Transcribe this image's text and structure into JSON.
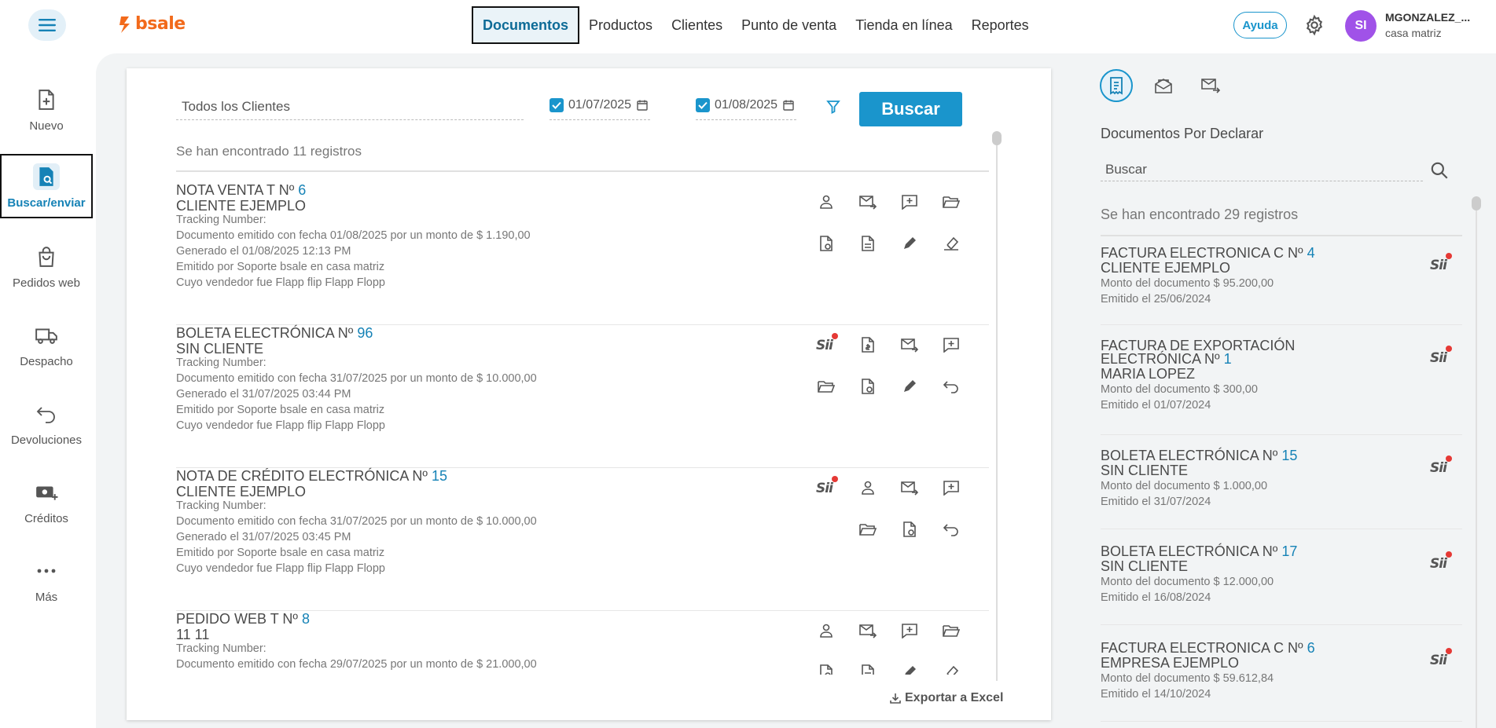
{
  "header": {
    "logo_text": "bsale",
    "nav": [
      "Documentos",
      "Productos",
      "Clientes",
      "Punto de venta",
      "Tienda en línea",
      "Reportes"
    ],
    "active_nav": "Documentos",
    "help_label": "Ayuda",
    "avatar_initials": "SI",
    "user_name": "MGONZALEZ_...",
    "user_branch": "casa matriz"
  },
  "sidebar": {
    "items": [
      {
        "label": "Nuevo",
        "icon": "file-plus-icon"
      },
      {
        "label": "Buscar/enviar",
        "icon": "file-search-icon",
        "active": true
      },
      {
        "label": "Pedidos web",
        "icon": "shopping-bag-icon"
      },
      {
        "label": "Despacho",
        "icon": "truck-icon"
      },
      {
        "label": "Devoluciones",
        "icon": "return-arrow-icon"
      },
      {
        "label": "Créditos",
        "icon": "money-plus-icon"
      },
      {
        "label": "Más",
        "icon": "more-dots-icon"
      }
    ]
  },
  "filters": {
    "client": "Todos los Clientes",
    "date_from": "01/07/2025",
    "date_to": "01/08/2025",
    "search_label": "Buscar"
  },
  "results": {
    "found_text": "Se han encontrado 11 registros",
    "documents": [
      {
        "title": "NOTA VENTA T Nº",
        "number": "6",
        "client": "CLIENTE EJEMPLO",
        "tracking": "Tracking Number:",
        "issued": "Documento emitido con fecha 01/08/2025 por un monto de $ 1.190,00",
        "generated": "Generado el 01/08/2025 12:13 PM",
        "emitted_by": "Emitido por Soporte bsale en casa matriz",
        "seller": "Cuyo vendedor fue Flapp flip Flapp Flopp"
      },
      {
        "title": "BOLETA ELECTRÓNICA Nº",
        "number": "96",
        "client": "SIN CLIENTE",
        "tracking": "Tracking Number:",
        "issued": "Documento emitido con fecha 31/07/2025 por un monto de $ 10.000,00",
        "generated": "Generado el 31/07/2025 03:44 PM",
        "emitted_by": "Emitido por Soporte bsale en casa matriz",
        "seller": "Cuyo vendedor fue Flapp flip Flapp Flopp"
      },
      {
        "title": "NOTA DE CRÉDITO ELECTRÓNICA Nº",
        "number": "15",
        "client": "CLIENTE EJEMPLO",
        "tracking": "Tracking Number:",
        "issued": "Documento emitido con fecha 31/07/2025 por un monto de $ 10.000,00",
        "generated": "Generado el 31/07/2025 03:45 PM",
        "emitted_by": "Emitido por Soporte bsale en casa matriz",
        "seller": "Cuyo vendedor fue Flapp flip Flapp Flopp"
      },
      {
        "title": "PEDIDO WEB T Nº",
        "number": "8",
        "client": "11 11",
        "tracking": "Tracking Number:",
        "issued": "Documento emitido con fecha 29/07/2025 por un monto de $ 21.000,00",
        "generated": "",
        "emitted_by": "",
        "seller": ""
      }
    ],
    "export_label": "Exportar a Excel"
  },
  "right_panel": {
    "title": "Documentos Por Declarar",
    "search_placeholder": "Buscar",
    "found_text": "Se han encontrado 29 registros",
    "items": [
      {
        "title": "FACTURA ELECTRONICA C Nº",
        "number": "4",
        "client": "CLIENTE EJEMPLO",
        "amount": "Monto del documento $ 95.200,00",
        "date": "Emitido el 25/06/2024"
      },
      {
        "title": "FACTURA DE EXPORTACIÓN",
        "title2": "ELECTRÓNICA Nº",
        "number": "1",
        "client": "MARIA LOPEZ",
        "amount": "Monto del documento $ 300,00",
        "date": "Emitido el 01/07/2024"
      },
      {
        "title": "BOLETA ELECTRÓNICA Nº",
        "number": "15",
        "client": "SIN CLIENTE",
        "amount": "Monto del documento $ 1.000,00",
        "date": "Emitido el 31/07/2024"
      },
      {
        "title": "BOLETA ELECTRÓNICA Nº",
        "number": "17",
        "client": "SIN CLIENTE",
        "amount": "Monto del documento $ 12.000,00",
        "date": "Emitido el 16/08/2024"
      },
      {
        "title": "FACTURA ELECTRONICA C Nº",
        "number": "6",
        "client": "EMPRESA EJEMPLO",
        "amount": "Monto del documento $ 59.612,84",
        "date": "Emitido el 14/10/2024"
      }
    ],
    "sii_label": "Sii"
  },
  "colors": {
    "accent": "#1a95cc",
    "brand": "#f26a1b",
    "avatar": "#a052e8",
    "alert_dot": "#e53935"
  }
}
